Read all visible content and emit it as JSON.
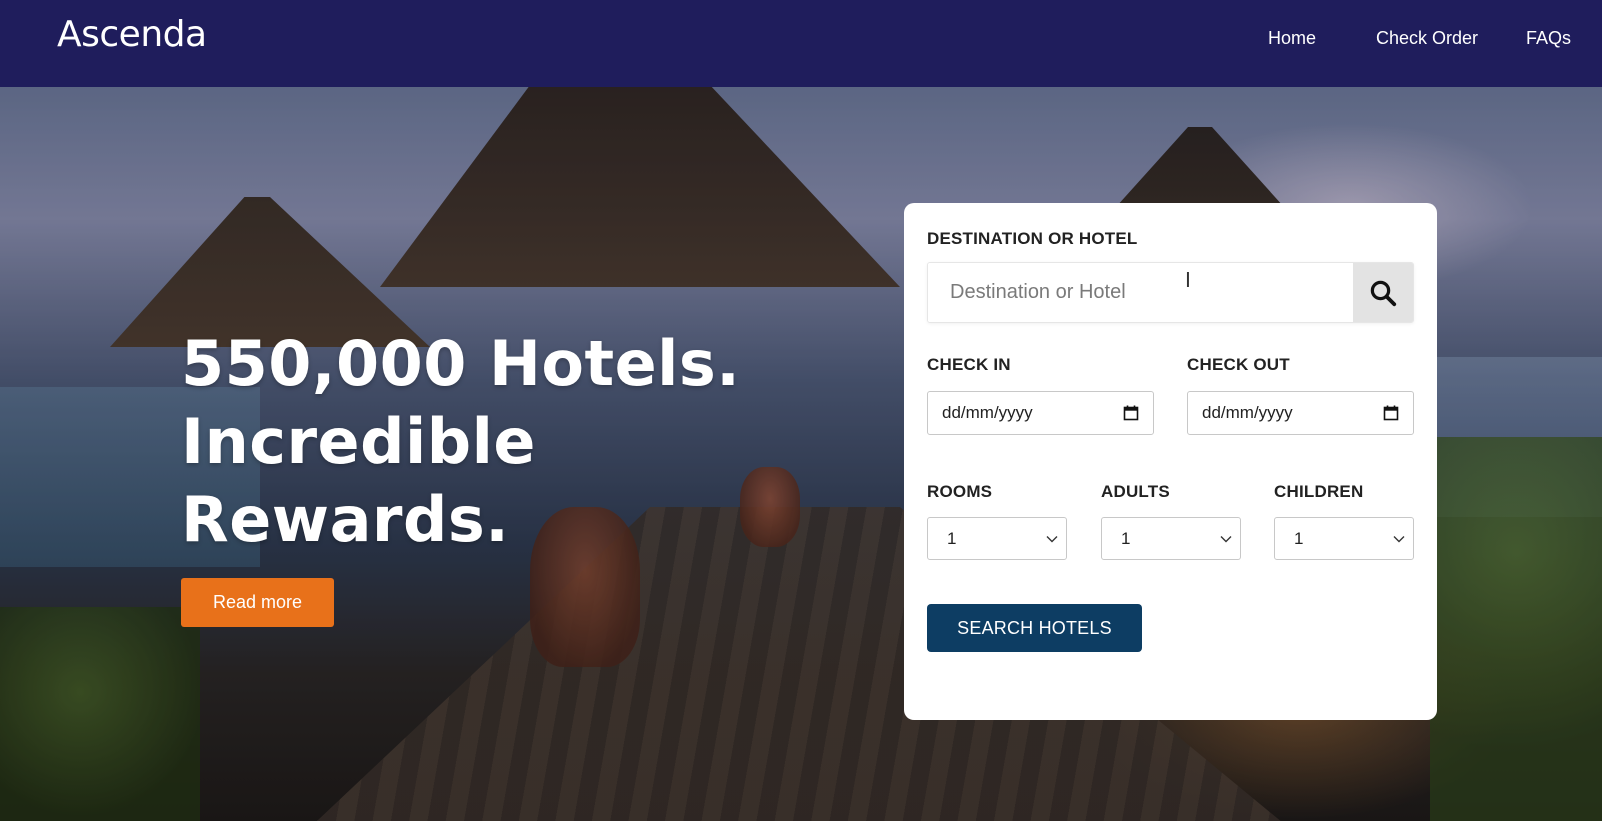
{
  "header": {
    "logo": "Ascenda",
    "nav": [
      {
        "label": "Home"
      },
      {
        "label": "Check Order"
      },
      {
        "label": "FAQs"
      }
    ]
  },
  "hero": {
    "headline_lines": [
      "550,000 Hotels.",
      "Incredible",
      "Rewards."
    ],
    "read_more_label": "Read more"
  },
  "search": {
    "destination_label": "DESTINATION OR HOTEL",
    "destination_placeholder": "Destination or Hotel",
    "destination_value": "",
    "check_in_label": "CHECK IN",
    "check_in_value": "dd/mm/yyyy",
    "check_out_label": "CHECK OUT",
    "check_out_value": "dd/mm/yyyy",
    "rooms_label": "ROOMS",
    "rooms_value": "1",
    "adults_label": "ADULTS",
    "adults_value": "1",
    "children_label": "CHILDREN",
    "children_value": "1",
    "submit_label": "SEARCH HOTELS"
  },
  "colors": {
    "navbar": "#1f1d5c",
    "read_more": "#e8711a",
    "search_button": "#0d3d63"
  },
  "icons": {
    "search": "magnifier-icon",
    "calendar": "calendar-icon",
    "dropdown": "chevron-down-icon"
  }
}
